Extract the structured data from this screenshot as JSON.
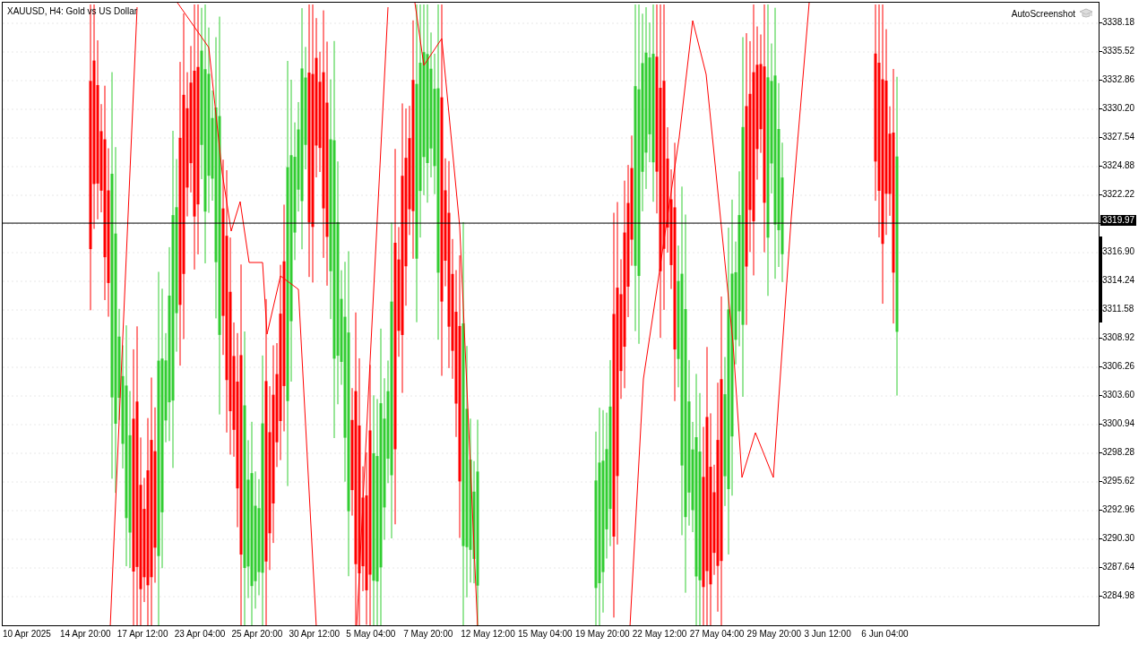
{
  "chart": {
    "symbol_title": "XAUUSD, H4:  Gold vs US Dollar",
    "watermark_label": "AutoScreenshot",
    "current_price": "3319.97",
    "price_labels_upper": [
      "3338.18",
      "3335.52",
      "3332.86",
      "3330.20",
      "3327.54",
      "3324.88",
      "3322.22"
    ],
    "price_labels_lower": [
      "3316.90",
      "3314.24",
      "3311.58",
      "3308.92",
      "3306.26",
      "3303.60",
      "3300.94",
      "3298.28",
      "3295.62",
      "3292.96",
      "3290.30",
      "3287.64",
      "3284.98"
    ],
    "time_labels": [
      "10 Apr 2025",
      "14 Apr 20:00",
      "17 Apr 12:00",
      "23 Apr 04:00",
      "25 Apr 20:00",
      "30 Apr 12:00",
      "5 May 04:00",
      "7 May 20:00",
      "12 May 12:00",
      "15 May 04:00",
      "19 May 20:00",
      "22 May 12:00",
      "27 May 04:00",
      "29 May 20:00",
      "3 Jun 12:00",
      "6 Jun 04:00"
    ]
  }
}
